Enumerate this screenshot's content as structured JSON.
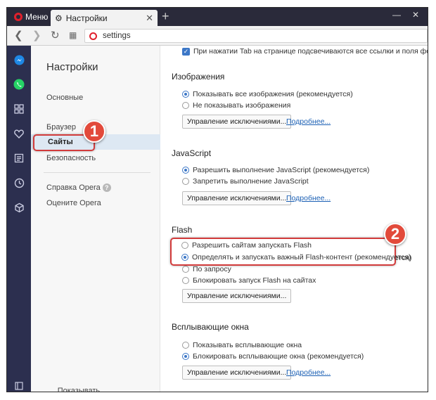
{
  "browser": {
    "menu_label": "Меню",
    "tab_title": "Настройки",
    "address": "settings"
  },
  "sidebar_icons": [
    "messenger-icon",
    "whatsapp-icon",
    "speed-dial-icon",
    "heart-icon",
    "news-icon",
    "history-icon",
    "cube-icon"
  ],
  "settings_nav": {
    "title": "Настройки",
    "items": [
      "Основные",
      "Браузер",
      "Сайты",
      "Безопасность"
    ],
    "help": "Справка Opera",
    "rate": "Оцените Opera",
    "show_more": "Показывать дополнительные"
  },
  "main": {
    "top_check": "При нажатии Tab на странице подсвечиваются все ссылки и поля форм",
    "images": {
      "title": "Изображения",
      "options": [
        "Показывать все изображения (рекомендуется)",
        "Не показывать изображения"
      ],
      "manage": "Управление исключениями...",
      "more": "Подробнее..."
    },
    "javascript": {
      "title": "JavaScript",
      "options": [
        "Разрешить выполнение JavaScript (рекомендуется)",
        "Запретить выполнение JavaScript"
      ],
      "manage": "Управление исключениями...",
      "more": "Подробнее..."
    },
    "flash": {
      "title": "Flash",
      "options": [
        "Разрешить сайтам запускать Flash",
        "Определять и запускать важный Flash-контент (рекомендуется)",
        "По запросу",
        "Блокировать запуск Flash на сайтах"
      ],
      "manage": "Управление исключениями..."
    },
    "popups": {
      "title": "Всплывающие окна",
      "options": [
        "Показывать всплывающие окна",
        "Блокировать всплывающие окна (рекомендуется)"
      ],
      "manage": "Управление исключениями...",
      "more": "Подробнее..."
    }
  },
  "callouts": [
    "1",
    "2"
  ],
  "colors": {
    "accent": "#3c77c7",
    "callout": "#e24a3b",
    "sidebar": "#2c2f4f",
    "link": "#1a5fb4"
  }
}
